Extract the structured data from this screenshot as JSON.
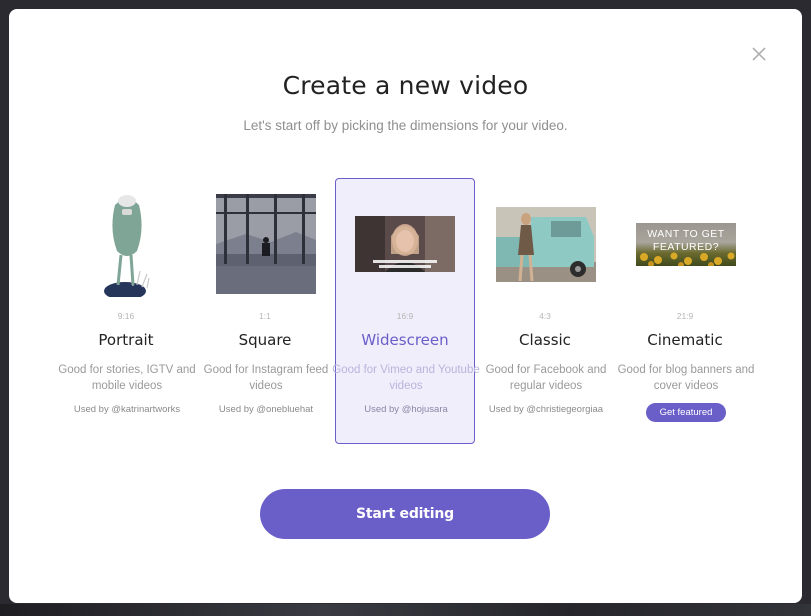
{
  "modal": {
    "title": "Create a new video",
    "subtitle": "Let's start off by picking the dimensions for your video.",
    "close_icon": "close-icon"
  },
  "options": [
    {
      "ratio": "9:16",
      "name": "Portrait",
      "description": "Good for stories, IGTV and mobile videos",
      "used_by": "Used by @katrinartworks"
    },
    {
      "ratio": "1:1",
      "name": "Square",
      "description": "Good for Instagram feed videos",
      "used_by": "Used by @onebluehat"
    },
    {
      "ratio": "16:9",
      "name": "Widescreen",
      "description": "Good for Vimeo and Youtube videos",
      "used_by": "Used by @hojusara",
      "selected": true
    },
    {
      "ratio": "4:3",
      "name": "Classic",
      "description": "Good for Facebook and regular videos",
      "used_by": "Used by @christiegeorgiaa"
    },
    {
      "ratio": "21:9",
      "name": "Cinematic",
      "description": "Good for blog banners and cover videos",
      "button": "Get featured",
      "thumb_text": "WANT TO GET FEATURED?"
    }
  ],
  "start_button": "Start editing",
  "colors": {
    "accent": "#6a5ec8",
    "selected_bg": "#f0eefb"
  }
}
